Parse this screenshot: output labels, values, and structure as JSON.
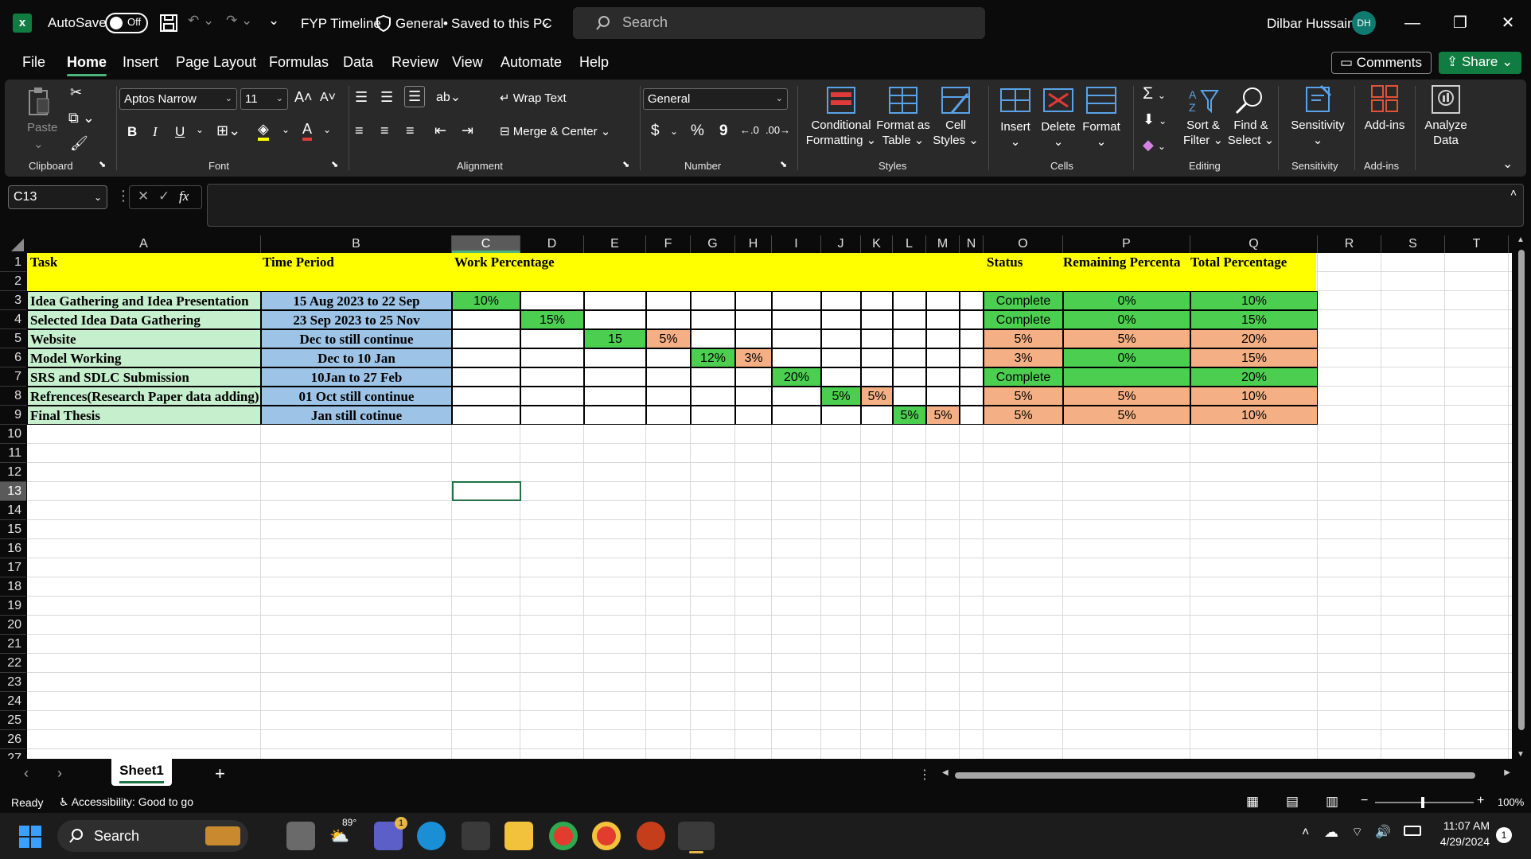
{
  "titlebar": {
    "autosave_label": "AutoSave",
    "autosave_state": "Off",
    "document_name": "FYP Timeline",
    "sensitivity": "General",
    "save_status": "Saved to this PC",
    "search_placeholder": "Search",
    "user_name": "Dilbar Hussain",
    "user_initials": "DH"
  },
  "menu": {
    "tabs": [
      "File",
      "Home",
      "Insert",
      "Page Layout",
      "Formulas",
      "Data",
      "Review",
      "View",
      "Automate",
      "Help"
    ],
    "comments": "Comments",
    "share": "Share"
  },
  "ribbon": {
    "clipboard": {
      "paste": "Paste",
      "label": "Clipboard"
    },
    "font": {
      "name": "Aptos Narrow",
      "size": "11",
      "bold": "B",
      "italic": "I",
      "underline": "U",
      "label": "Font"
    },
    "alignment": {
      "wrap_text": "Wrap Text",
      "merge_center": "Merge & Center",
      "label": "Alignment"
    },
    "number": {
      "format": "General",
      "currency": "$",
      "percent": "%",
      "comma": "9",
      "label": "Number"
    },
    "styles": {
      "conditional_1": "Conditional",
      "conditional_2": "Formatting",
      "format_table_1": "Format as",
      "format_table_2": "Table",
      "cell_styles_1": "Cell",
      "cell_styles_2": "Styles",
      "label": "Styles"
    },
    "cells": {
      "insert": "Insert",
      "delete": "Delete",
      "format": "Format",
      "label": "Cells"
    },
    "editing": {
      "sort_1": "Sort &",
      "sort_2": "Filter",
      "find_1": "Find &",
      "find_2": "Select",
      "label": "Editing"
    },
    "sensitivity": {
      "button": "Sensitivity",
      "label": "Sensitivity"
    },
    "addins": {
      "button": "Add-ins",
      "label": "Add-ins"
    },
    "analyze": {
      "line1": "Analyze",
      "line2": "Data"
    }
  },
  "formula_bar": {
    "name_box": "C13",
    "fx": "fx",
    "formula": ""
  },
  "columns": [
    "A",
    "B",
    "C",
    "D",
    "E",
    "F",
    "G",
    "H",
    "I",
    "J",
    "K",
    "L",
    "M",
    "N",
    "O",
    "P",
    "Q",
    "R",
    "S",
    "T"
  ],
  "rows": [
    "1",
    "2",
    "3",
    "4",
    "5",
    "6",
    "7",
    "8",
    "9",
    "10",
    "11",
    "12",
    "13",
    "14",
    "15",
    "16",
    "17",
    "18",
    "19",
    "20",
    "21",
    "22",
    "23",
    "24",
    "25",
    "26",
    "27"
  ],
  "sheet": {
    "headers": {
      "task": "Task",
      "time_period": "Time Period",
      "work_percentage": "Work Percentage",
      "status": "Status",
      "remaining": "Remaining Percenta",
      "total": "Total Percentage"
    },
    "tasks": [
      {
        "task": "Idea Gathering and Idea Presentation",
        "period": "15 Aug 2023 to 22 Sep",
        "status": "Complete",
        "remaining": "0%",
        "total": "10%"
      },
      {
        "task": "Selected Idea Data Gathering",
        "period": "23 Sep 2023 to 25 Nov",
        "status": "Complete",
        "remaining": "0%",
        "total": "15%"
      },
      {
        "task": "Website",
        "period": "Dec to still continue",
        "status": "5%",
        "remaining": "5%",
        "total": "20%"
      },
      {
        "task": "Model Working",
        "period": "Dec to 10 Jan",
        "status": "3%",
        "remaining": "0%",
        "total": "15%"
      },
      {
        "task": "SRS and SDLC Submission",
        "period": "10Jan to 27 Feb",
        "status": "Complete",
        "remaining": "",
        "total": "20%"
      },
      {
        "task": "Refrences(Research Paper data adding)",
        "period": "01 Oct still continue",
        "status": "5%",
        "remaining": "5%",
        "total": "10%"
      },
      {
        "task": "Final Thesis",
        "period": "Jan still cotinue",
        "status": "5%",
        "remaining": "5%",
        "total": "10%"
      }
    ],
    "timeline_cells": [
      {
        "row": 0,
        "col": "C",
        "value": "10%",
        "color": "#4cce50"
      },
      {
        "row": 1,
        "col": "D",
        "value": "15%",
        "color": "#4cce50"
      },
      {
        "row": 2,
        "col": "E",
        "value": "15",
        "color": "#4cce50"
      },
      {
        "row": 2,
        "col": "F",
        "value": "5%",
        "color": "#f4b084"
      },
      {
        "row": 3,
        "col": "G",
        "value": "12%",
        "color": "#4cce50"
      },
      {
        "row": 3,
        "col": "H",
        "value": "3%",
        "color": "#f4b084"
      },
      {
        "row": 4,
        "col": "I",
        "value": "20%",
        "color": "#4cce50"
      },
      {
        "row": 5,
        "col": "J",
        "value": "5%",
        "color": "#4cce50"
      },
      {
        "row": 5,
        "col": "K",
        "value": "5%",
        "color": "#f4b084"
      },
      {
        "row": 6,
        "col": "L",
        "value": "5%",
        "color": "#4cce50"
      },
      {
        "row": 6,
        "col": "M",
        "value": "5%",
        "color": "#f4b084"
      }
    ]
  },
  "sheet_tabs": {
    "active": "Sheet1",
    "add": "+"
  },
  "status_bar": {
    "ready": "Ready",
    "accessibility": "Accessibility: Good to go",
    "zoom": "100%"
  },
  "taskbar": {
    "search": "Search",
    "weather": "89°",
    "chat_badge": "1",
    "time": "11:07 AM",
    "date": "4/29/2024",
    "notif": "1"
  },
  "colors": {
    "header_yellow": "#ffff00",
    "task_green": "#c6efce",
    "period_blue": "#9dc3e6",
    "done_green": "#4cce50",
    "pending_salmon": "#f4b084",
    "accent": "#217346"
  }
}
